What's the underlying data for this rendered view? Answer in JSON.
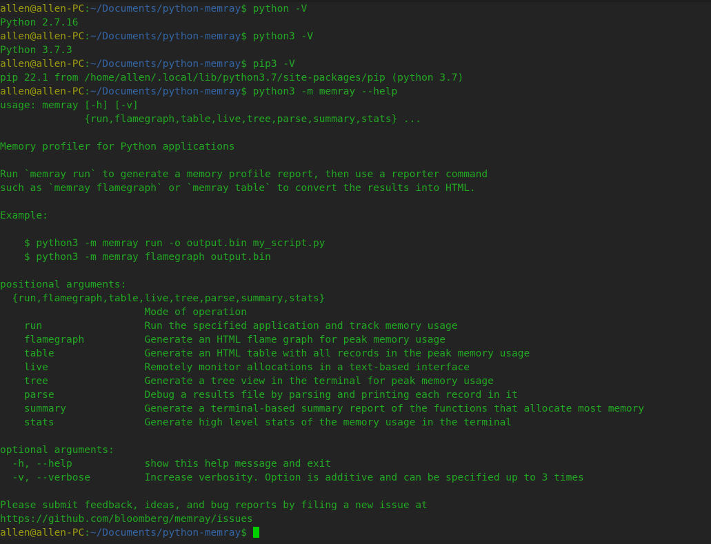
{
  "terminal": {
    "background_color": "#232323",
    "prompt": {
      "user_host": "allen@allen-PC",
      "separator": ":",
      "path": "~/Documents/python-memray",
      "sigil": "$",
      "user_host_color": "#9a9a10",
      "path_color": "#3465a4",
      "sigil_color": "#24a824"
    },
    "output_color": "#22a822",
    "cursor": {
      "shape": "block",
      "color": "#00d000"
    },
    "lines": [
      {
        "type": "prompt",
        "command": " python -V"
      },
      {
        "type": "output",
        "text": "Python 2.7.16"
      },
      {
        "type": "prompt",
        "command": " python3 -V"
      },
      {
        "type": "output",
        "text": "Python 3.7.3"
      },
      {
        "type": "prompt",
        "command": " pip3 -V"
      },
      {
        "type": "output",
        "text": "pip 22.1 from /home/allen/.local/lib/python3.7/site-packages/pip (python 3.7)"
      },
      {
        "type": "prompt",
        "command": " python3 -m memray --help"
      },
      {
        "type": "output",
        "text": "usage: memray [-h] [-v]"
      },
      {
        "type": "output",
        "text": "              {run,flamegraph,table,live,tree,parse,summary,stats} ..."
      },
      {
        "type": "output",
        "text": ""
      },
      {
        "type": "output",
        "text": "Memory profiler for Python applications"
      },
      {
        "type": "output",
        "text": ""
      },
      {
        "type": "output",
        "text": "Run `memray run` to generate a memory profile report, then use a reporter command"
      },
      {
        "type": "output",
        "text": "such as `memray flamegraph` or `memray table` to convert the results into HTML."
      },
      {
        "type": "output",
        "text": ""
      },
      {
        "type": "output",
        "text": "Example:"
      },
      {
        "type": "output",
        "text": ""
      },
      {
        "type": "output",
        "text": "    $ python3 -m memray run -o output.bin my_script.py"
      },
      {
        "type": "output",
        "text": "    $ python3 -m memray flamegraph output.bin"
      },
      {
        "type": "output",
        "text": ""
      },
      {
        "type": "output",
        "text": "positional arguments:"
      },
      {
        "type": "output",
        "text": "  {run,flamegraph,table,live,tree,parse,summary,stats}"
      },
      {
        "type": "output",
        "text": "                        Mode of operation"
      },
      {
        "type": "output",
        "text": "    run                 Run the specified application and track memory usage"
      },
      {
        "type": "output",
        "text": "    flamegraph          Generate an HTML flame graph for peak memory usage"
      },
      {
        "type": "output",
        "text": "    table               Generate an HTML table with all records in the peak memory usage"
      },
      {
        "type": "output",
        "text": "    live                Remotely monitor allocations in a text-based interface"
      },
      {
        "type": "output",
        "text": "    tree                Generate a tree view in the terminal for peak memory usage"
      },
      {
        "type": "output",
        "text": "    parse               Debug a results file by parsing and printing each record in it"
      },
      {
        "type": "output",
        "text": "    summary             Generate a terminal-based summary report of the functions that allocate most memory"
      },
      {
        "type": "output",
        "text": "    stats               Generate high level stats of the memory usage in the terminal"
      },
      {
        "type": "output",
        "text": ""
      },
      {
        "type": "output",
        "text": "optional arguments:"
      },
      {
        "type": "output",
        "text": "  -h, --help            show this help message and exit"
      },
      {
        "type": "output",
        "text": "  -v, --verbose         Increase verbosity. Option is additive and can be specified up to 3 times"
      },
      {
        "type": "output",
        "text": ""
      },
      {
        "type": "output",
        "text": "Please submit feedback, ideas, and bug reports by filing a new issue at"
      },
      {
        "type": "output",
        "text": "https://github.com/bloomberg/memray/issues"
      },
      {
        "type": "prompt_cursor",
        "command": " "
      }
    ]
  }
}
